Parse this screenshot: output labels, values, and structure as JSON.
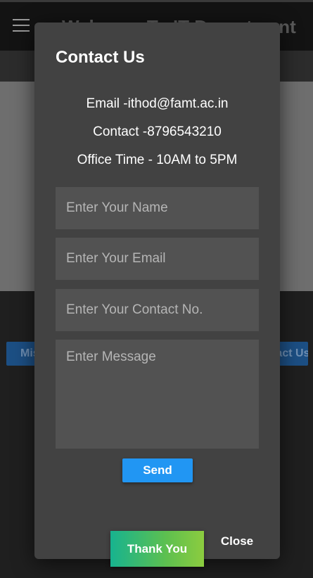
{
  "appbar": {
    "title": "Welcome To IT Department",
    "menu_icon": "hamburger-menu-icon"
  },
  "background_buttons": {
    "left_label": "Mission",
    "right_label": "Contact Us"
  },
  "modal": {
    "title": "Contact Us",
    "email_line": "Email -ithod@famt.ac.in",
    "contact_line": "Contact -8796543210",
    "office_time_line": "Office Time - 10AM to 5PM",
    "fields": {
      "name_placeholder": "Enter Your Name",
      "email_placeholder": "Enter Your Email",
      "contact_placeholder": "Enter Your Contact No.",
      "message_placeholder": "Enter Message"
    },
    "send_label": "Send",
    "thank_you_label": "Thank You",
    "close_label": "Close"
  },
  "colors": {
    "send_button": "#2196f3",
    "modal_background": "#424242",
    "thank_you_gradient_start": "#17b38f",
    "thank_you_gradient_end": "#8ccc3f"
  }
}
